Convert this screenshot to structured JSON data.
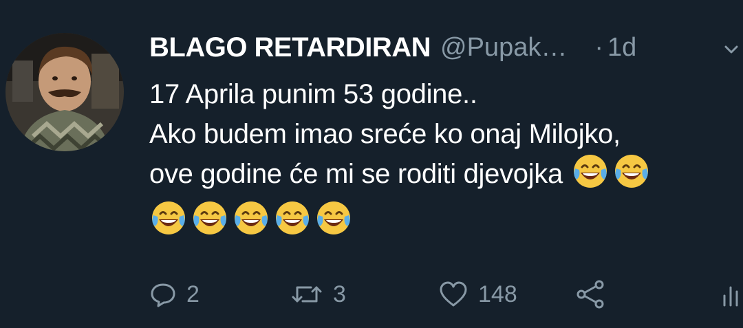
{
  "tweet": {
    "display_name": "BLAGO RETARDIRAN",
    "handle": "@Pupak…",
    "dot": "·",
    "time": "1d",
    "lines": [
      "17 Aprila punim 53 godine..",
      "Ako budem imao sreće ko onaj Milojko,",
      "ove godine će mi se roditi djevojka"
    ],
    "emoji_name": "face-with-tears-of-joy-icon",
    "inline_emoji_count": 2,
    "row_emoji_count": 5,
    "reply_count": "2",
    "retweet_count": "3",
    "like_count": "148"
  },
  "colors": {
    "background": "#15202b",
    "text": "#ffffff",
    "secondary": "#8899a6"
  }
}
